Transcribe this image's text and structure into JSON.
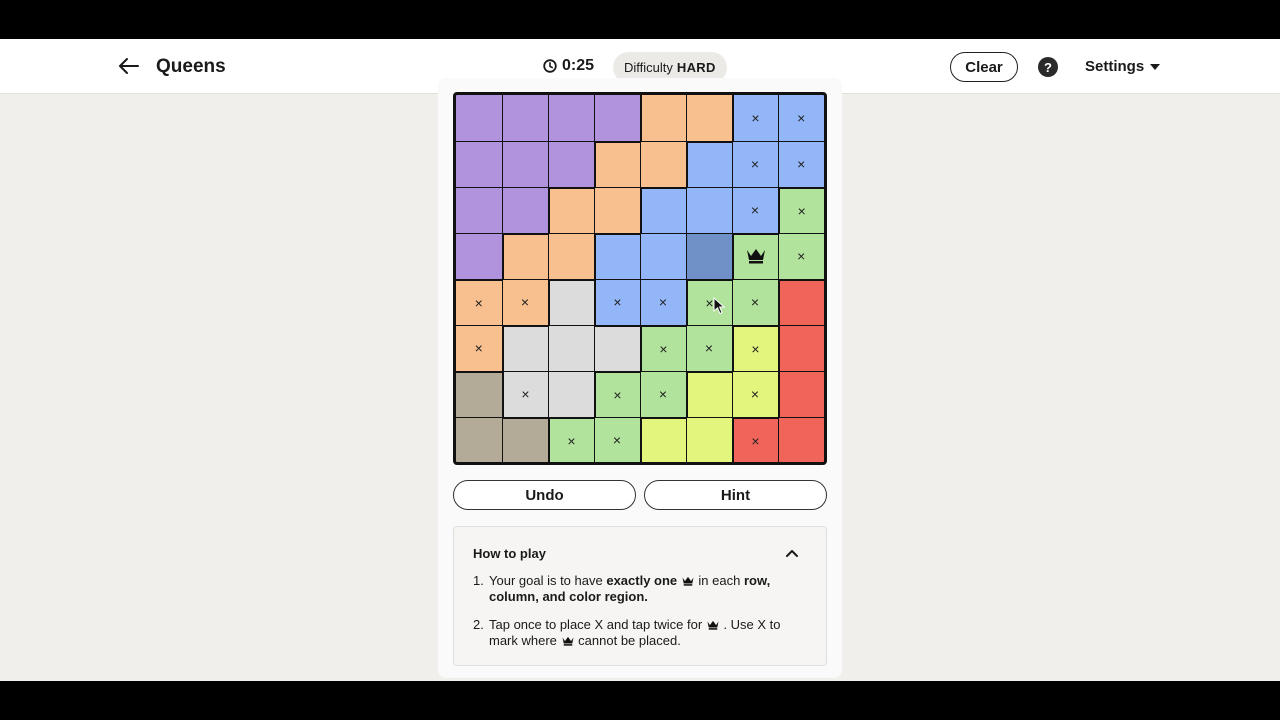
{
  "header": {
    "title": "Queens",
    "timer": "0:25",
    "difficulty_label": "Difficulty",
    "difficulty_value": "HARD",
    "clear_label": "Clear",
    "help_label": "?",
    "settings_label": "Settings"
  },
  "colors": {
    "purple": "#b092dd",
    "orange": "#f8c08e",
    "blue": "#93b6f8",
    "blue_hover": "#7090c8",
    "green": "#b1e39c",
    "red": "#f0645a",
    "gray": "#dcdcdc",
    "tan": "#b4aa98",
    "yellow": "#e4f57e"
  },
  "board": {
    "size": 8,
    "regions": [
      [
        "purple",
        "purple",
        "purple",
        "purple",
        "orange",
        "orange",
        "blue",
        "blue"
      ],
      [
        "purple",
        "purple",
        "purple",
        "orange",
        "orange",
        "blue",
        "blue",
        "blue"
      ],
      [
        "purple",
        "purple",
        "orange",
        "orange",
        "blue",
        "blue",
        "blue",
        "green"
      ],
      [
        "purple",
        "orange",
        "orange",
        "blue",
        "blue",
        "blue",
        "green",
        "green"
      ],
      [
        "orange",
        "orange",
        "gray",
        "blue",
        "blue",
        "green",
        "green",
        "red"
      ],
      [
        "orange",
        "gray",
        "gray",
        "gray",
        "green",
        "green",
        "yellow",
        "red"
      ],
      [
        "tan",
        "gray",
        "gray",
        "green",
        "green",
        "yellow",
        "yellow",
        "red"
      ],
      [
        "tan",
        "tan",
        "green",
        "green",
        "yellow",
        "yellow",
        "red",
        "red"
      ]
    ],
    "marks": [
      [
        "",
        "",
        "",
        "",
        "",
        "",
        "x",
        "x"
      ],
      [
        "",
        "",
        "",
        "",
        "",
        "",
        "x",
        "x"
      ],
      [
        "",
        "",
        "",
        "",
        "",
        "",
        "x",
        "x"
      ],
      [
        "",
        "",
        "",
        "",
        "",
        "",
        "queen",
        "x"
      ],
      [
        "x",
        "x",
        "",
        "x",
        "x",
        "x",
        "x",
        ""
      ],
      [
        "x",
        "",
        "",
        "",
        "x",
        "x",
        "x",
        ""
      ],
      [
        "",
        "x",
        "",
        "x",
        "x",
        "",
        "x",
        ""
      ],
      [
        "",
        "",
        "x",
        "x",
        "",
        "",
        "x",
        ""
      ]
    ],
    "hover_cell": [
      3,
      5
    ]
  },
  "actions": {
    "undo_label": "Undo",
    "hint_label": "Hint"
  },
  "howto": {
    "title": "How to play",
    "item1_num": "1.",
    "item1_a": "Your goal is to have",
    "item1_b": "exactly one",
    "item1_c": "in each",
    "item1_d": "row, column, and color region.",
    "item2_num": "2.",
    "item2_a": "Tap once to place X and tap twice for",
    "item2_b": ". Use X to mark where",
    "item2_c": "cannot be placed."
  }
}
